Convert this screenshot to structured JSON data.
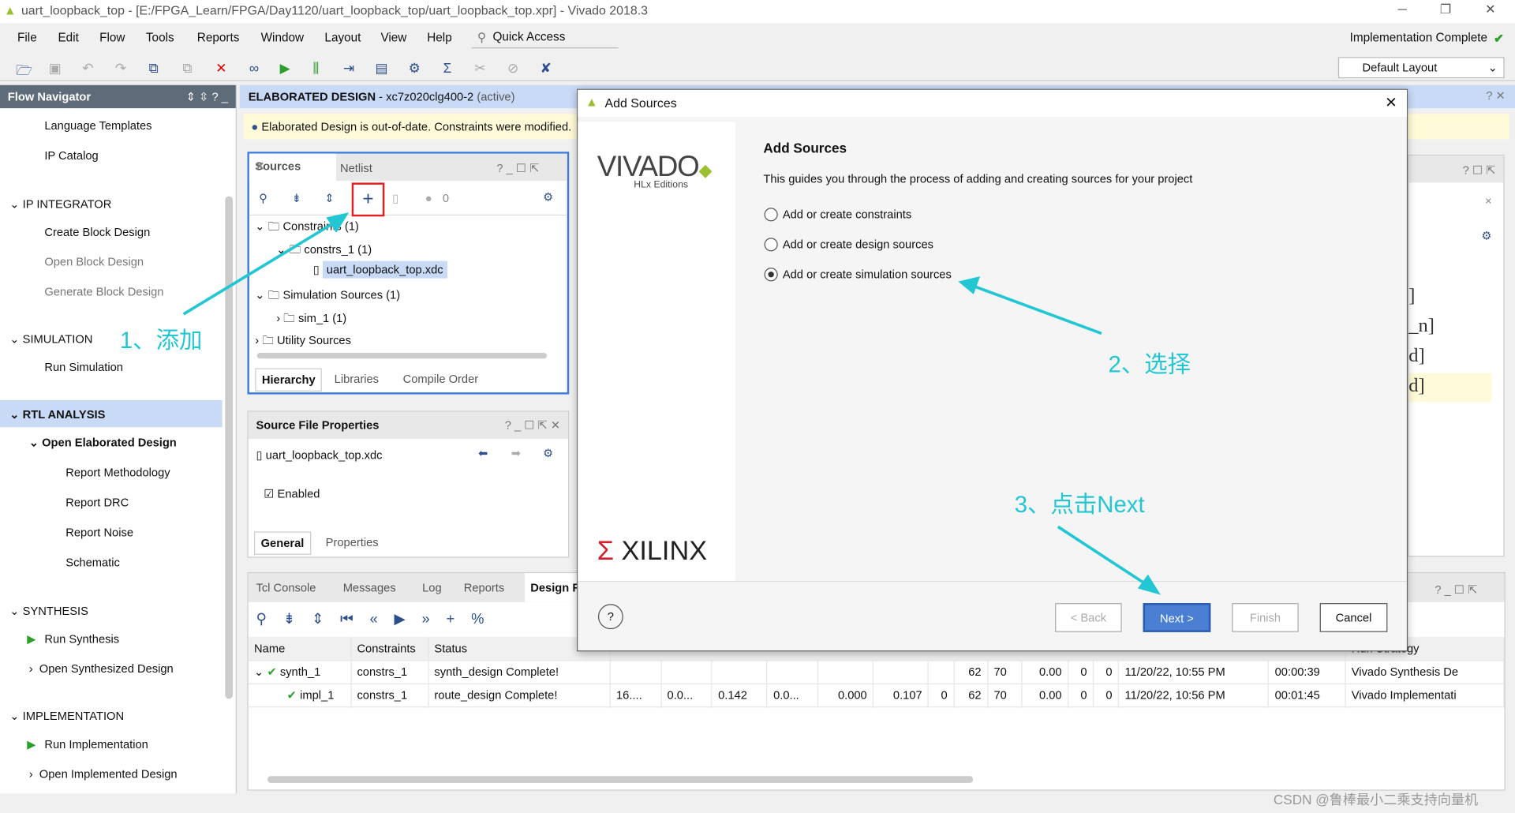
{
  "window": {
    "title": "uart_loopback_top - [E:/FPGA_Learn/FPGA/Day1120/uart_loopback_top/uart_loopback_top.xpr] - Vivado 2018.3"
  },
  "menu": [
    "File",
    "Edit",
    "Flow",
    "Tools",
    "Reports",
    "Window",
    "Layout",
    "View",
    "Help"
  ],
  "quick_access": "Quick Access",
  "status": "Implementation Complete",
  "layout_select": "Default Layout",
  "nav": {
    "title": "Flow Navigator",
    "items": [
      "Language Templates",
      "IP Catalog",
      "IP INTEGRATOR",
      "Create Block Design",
      "Open Block Design",
      "Generate Block Design",
      "SIMULATION",
      "Run Simulation",
      "RTL ANALYSIS",
      "Open Elaborated Design",
      "Report Methodology",
      "Report DRC",
      "Report Noise",
      "Schematic",
      "SYNTHESIS",
      "Run Synthesis",
      "Open Synthesized Design",
      "IMPLEMENTATION",
      "Run Implementation",
      "Open Implemented Design"
    ]
  },
  "main": {
    "header": "ELABORATED DESIGN",
    "header_part": " - xc7z020clg400-2",
    "header_active": "(active)",
    "banner": "Elaborated Design is out-of-date. Constraints were modified."
  },
  "sources": {
    "tabs": [
      "Sources",
      "Netlist"
    ],
    "count": "0",
    "tree": [
      "Constraints (1)",
      "constrs_1 (1)",
      "uart_loopback_top.xdc",
      "Simulation Sources (1)",
      "sim_1 (1)",
      "Utility Sources"
    ],
    "bottom_tabs": [
      "Hierarchy",
      "Libraries",
      "Compile Order"
    ]
  },
  "props": {
    "title": "Source File Properties",
    "file": "uart_loopback_top.xdc",
    "enabled": "Enabled",
    "tabs": [
      "General",
      "Properties"
    ]
  },
  "bottom": {
    "tabs": [
      "Tcl Console",
      "Messages",
      "Log",
      "Reports",
      "Design R"
    ],
    "columns": [
      "Name",
      "Constraints",
      "Status",
      "Run Strategy"
    ],
    "rows": [
      [
        "synth_1",
        "constrs_1",
        "synth_design Complete!",
        "",
        "",
        "",
        "",
        "",
        "",
        "",
        "62",
        "70",
        "0.00",
        "0",
        "0",
        "11/20/22, 10:55 PM",
        "00:00:39",
        "Vivado Synthesis De"
      ],
      [
        "impl_1",
        "constrs_1",
        "route_design Complete!",
        "16....",
        "0.0...",
        "0.142",
        "0.0...",
        "0.000",
        "0.107",
        "0",
        "62",
        "70",
        "0.00",
        "0",
        "0",
        "11/20/22, 10:56 PM",
        "00:01:45",
        "Vivado Implementati"
      ]
    ]
  },
  "right_code": [
    "]",
    "_n]",
    "d]",
    "d]"
  ],
  "dialog": {
    "title": "Add Sources",
    "logo_vivado": "VIVADO",
    "logo_sub": "HLx Editions",
    "logo_xilinx": "XILINX",
    "heading": "Add Sources",
    "desc": "This guides you through the process of adding and creating sources for your project",
    "options": [
      {
        "label": "Add or create constraints",
        "selected": false
      },
      {
        "label": "Add or create design sources",
        "selected": false
      },
      {
        "label": "Add or create simulation sources",
        "selected": true
      }
    ],
    "buttons": {
      "back": "< Back",
      "next": "Next >",
      "finish": "Finish",
      "cancel": "Cancel",
      "help": "?"
    }
  },
  "annotations": {
    "a1": "1、添加",
    "a2": "2、选择",
    "a3": "3、点击Next",
    "color": "#23c6d3"
  },
  "watermark": "CSDN @鲁棒最小二乘支持向量机"
}
